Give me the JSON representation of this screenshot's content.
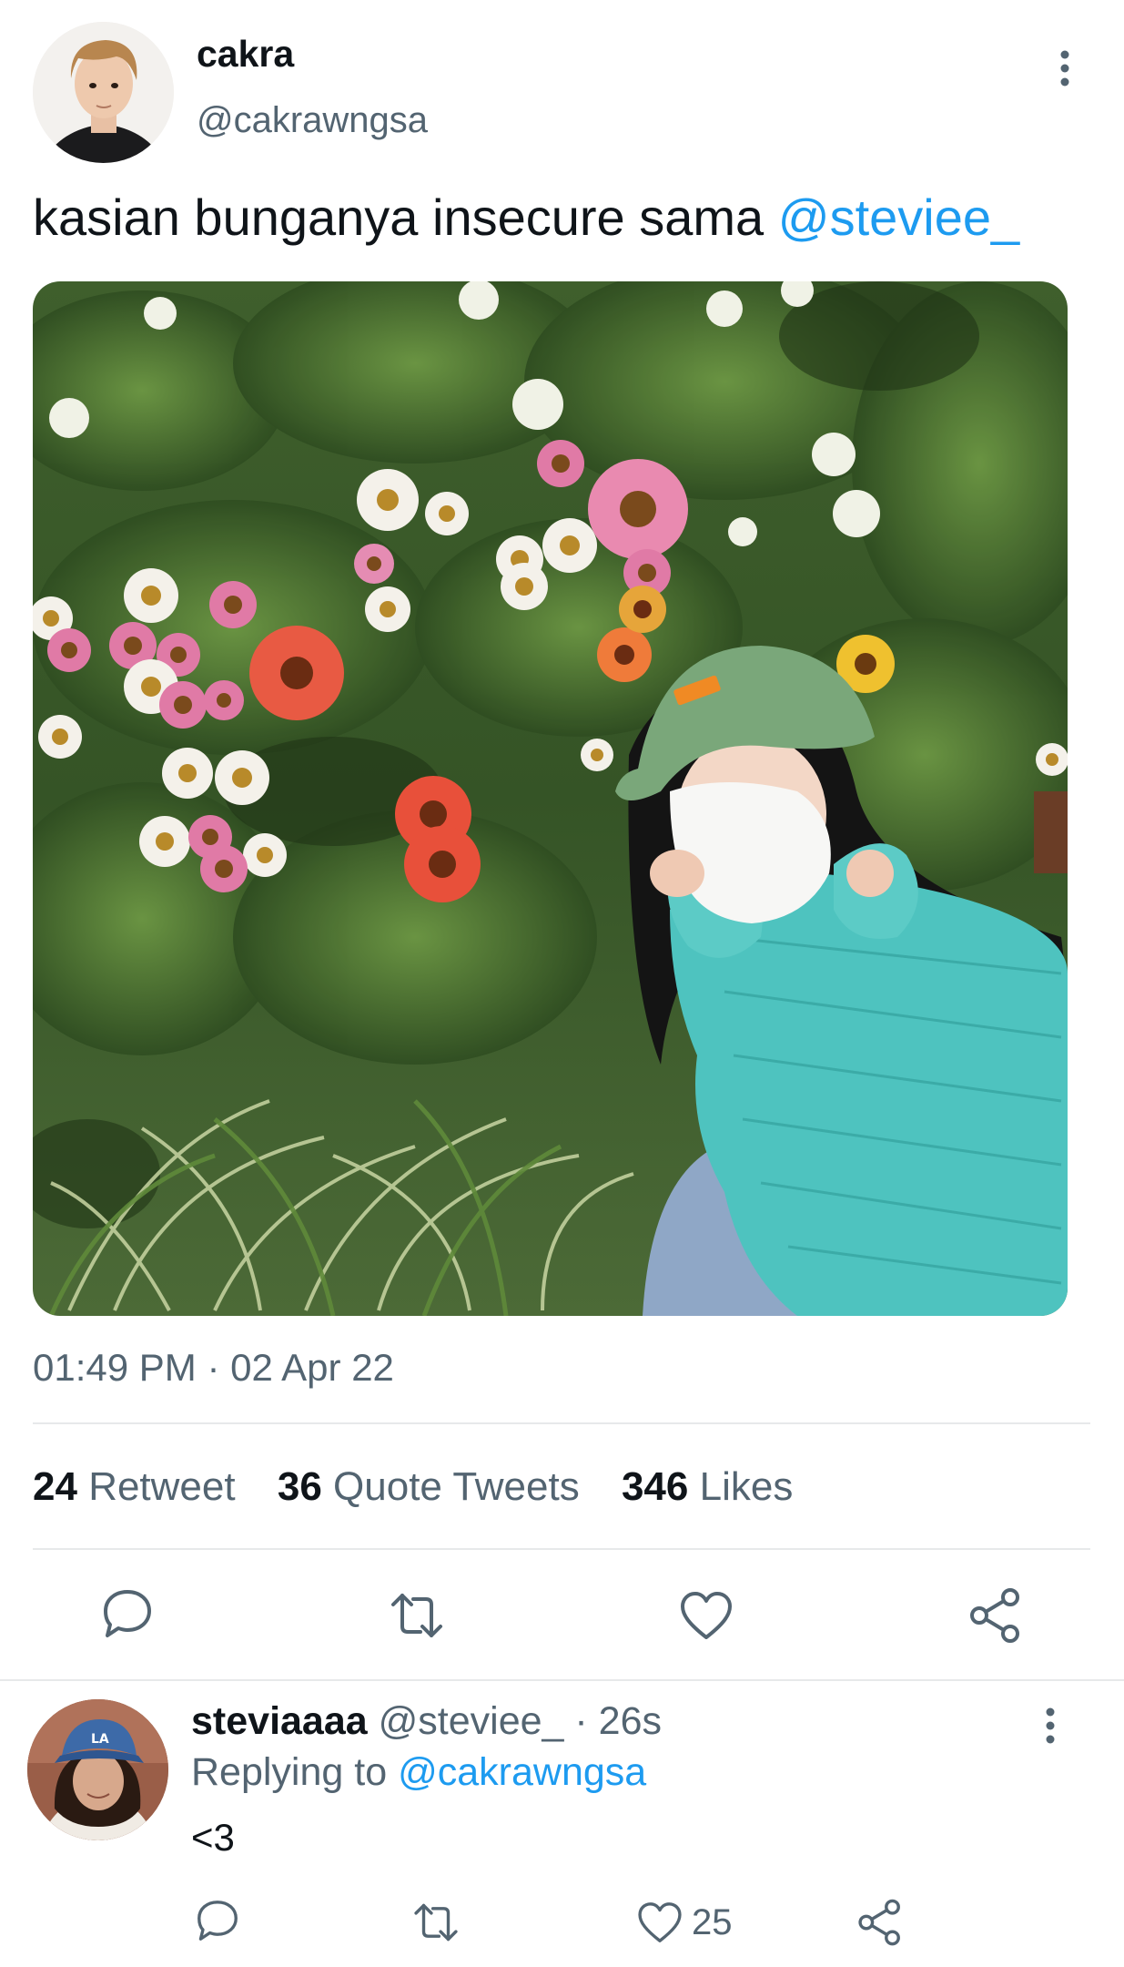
{
  "tweet": {
    "author_name": "cakra",
    "author_handle": "@cakrawngsa",
    "text_prefix": "kasian bunganya insecure sama ",
    "mention": "@steviee_",
    "timestamp": "01:49 PM · 02 Apr 22",
    "stats": {
      "retweet_count": "24",
      "retweet_label": "Retweet",
      "quote_count": "36",
      "quote_label": "Quote Tweets",
      "likes_count": "346",
      "likes_label": "Likes"
    },
    "actions": [
      "reply-icon",
      "retweet-icon",
      "heart-icon",
      "share-icon"
    ]
  },
  "reply": {
    "author_name": "steviaaaa",
    "author_handle": "@steviee_",
    "time": "· 26s",
    "replying_label": "Replying to",
    "replying_to": "@cakrawngsa",
    "text": "<3",
    "like_count": "25",
    "actions": [
      "reply-icon",
      "retweet-icon",
      "heart-icon",
      "share-icon"
    ]
  },
  "colors": {
    "accent": "#1d9bf0",
    "secondary_text": "#536471",
    "primary_text": "#0f1419",
    "divider": "#e7e9ea"
  }
}
